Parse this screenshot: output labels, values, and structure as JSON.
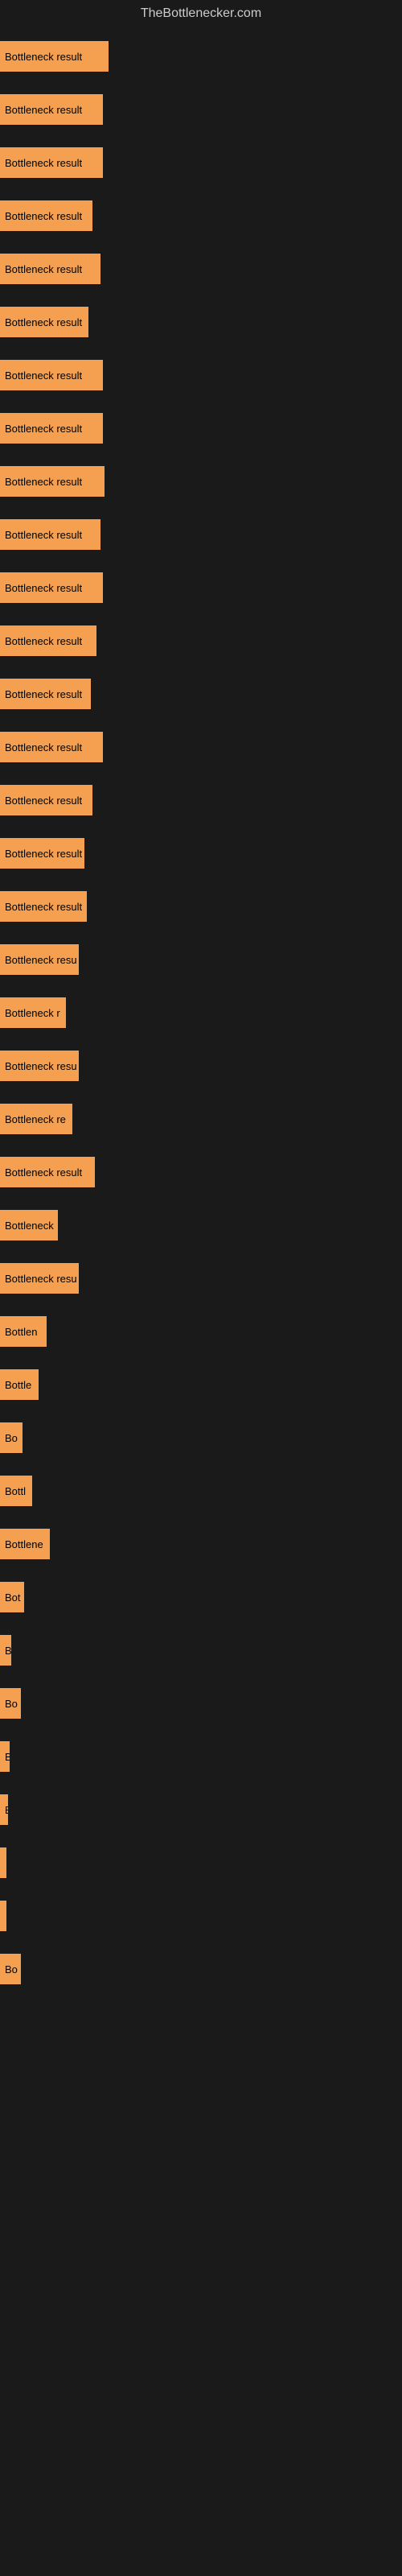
{
  "site_title": "TheBottlenecker.com",
  "bars": [
    {
      "label": "Bottleneck result",
      "width": 135
    },
    {
      "label": "Bottleneck result",
      "width": 128
    },
    {
      "label": "Bottleneck result",
      "width": 128
    },
    {
      "label": "Bottleneck result",
      "width": 115
    },
    {
      "label": "Bottleneck result",
      "width": 125
    },
    {
      "label": "Bottleneck result",
      "width": 110
    },
    {
      "label": "Bottleneck result",
      "width": 128
    },
    {
      "label": "Bottleneck result",
      "width": 128
    },
    {
      "label": "Bottleneck result",
      "width": 130
    },
    {
      "label": "Bottleneck result",
      "width": 125
    },
    {
      "label": "Bottleneck result",
      "width": 128
    },
    {
      "label": "Bottleneck result",
      "width": 120
    },
    {
      "label": "Bottleneck result",
      "width": 113
    },
    {
      "label": "Bottleneck result",
      "width": 128
    },
    {
      "label": "Bottleneck result",
      "width": 115
    },
    {
      "label": "Bottleneck result",
      "width": 105
    },
    {
      "label": "Bottleneck result",
      "width": 108
    },
    {
      "label": "Bottleneck resu",
      "width": 98
    },
    {
      "label": "Bottleneck r",
      "width": 82
    },
    {
      "label": "Bottleneck resu",
      "width": 98
    },
    {
      "label": "Bottleneck re",
      "width": 90
    },
    {
      "label": "Bottleneck result",
      "width": 118
    },
    {
      "label": "Bottleneck",
      "width": 72
    },
    {
      "label": "Bottleneck resu",
      "width": 98
    },
    {
      "label": "Bottlen",
      "width": 58
    },
    {
      "label": "Bottle",
      "width": 48
    },
    {
      "label": "Bo",
      "width": 28
    },
    {
      "label": "Bottl",
      "width": 40
    },
    {
      "label": "Bottlene",
      "width": 62
    },
    {
      "label": "Bot",
      "width": 30
    },
    {
      "label": "B",
      "width": 14
    },
    {
      "label": "Bo",
      "width": 26
    },
    {
      "label": "B",
      "width": 12
    },
    {
      "label": "B",
      "width": 10
    },
    {
      "label": "",
      "width": 8
    },
    {
      "label": "",
      "width": 8
    },
    {
      "label": "Bo",
      "width": 26
    }
  ]
}
